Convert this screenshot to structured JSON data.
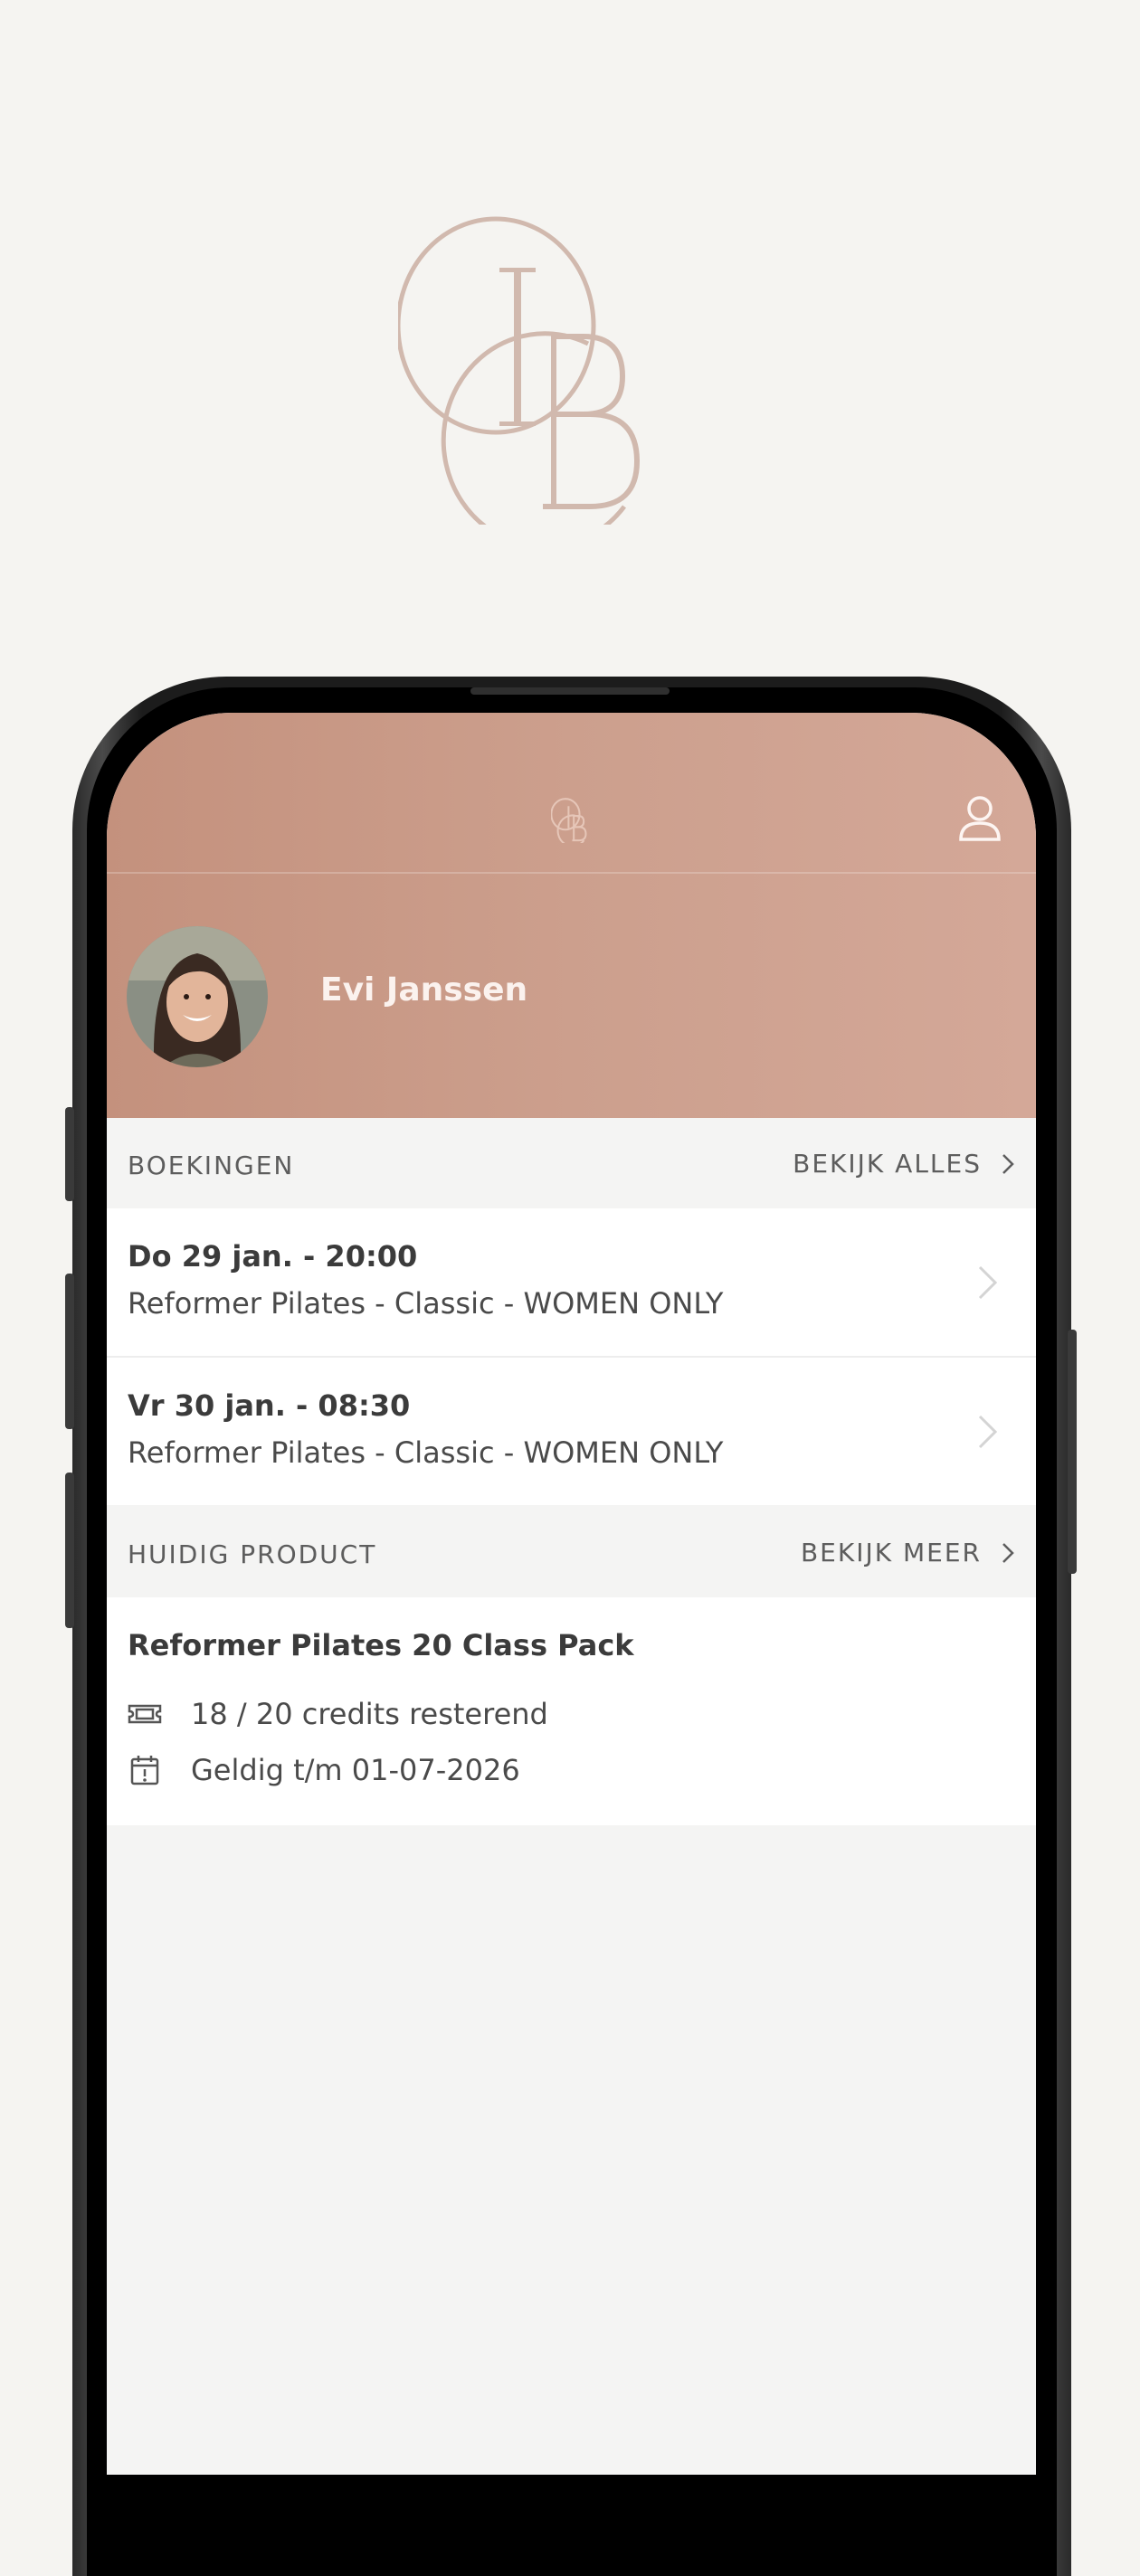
{
  "profile": {
    "name": "Evi Janssen"
  },
  "bookings_section": {
    "title": "BOEKINGEN",
    "link": "BEKIJK ALLES"
  },
  "bookings": [
    {
      "date": "Do 29 jan. - 20:00",
      "class": "Reformer Pilates - Classic - WOMEN ONLY"
    },
    {
      "date": "Vr 30 jan. - 08:30",
      "class": "Reformer Pilates - Classic - WOMEN ONLY"
    }
  ],
  "product_section": {
    "title": "HUIDIG PRODUCT",
    "link": "BEKIJK MEER"
  },
  "product": {
    "name": "Reformer Pilates 20 Class Pack",
    "credits": "18 / 20 credits resterend",
    "valid": "Geldig t/m 01-07-2026"
  },
  "colors": {
    "brand": "#c4917d",
    "logo": "#d1b9ae",
    "background": "#f5f4f1"
  },
  "icons": [
    "logo-monogram",
    "user-icon",
    "chevron-right-icon",
    "ticket-icon",
    "calendar-icon"
  ]
}
